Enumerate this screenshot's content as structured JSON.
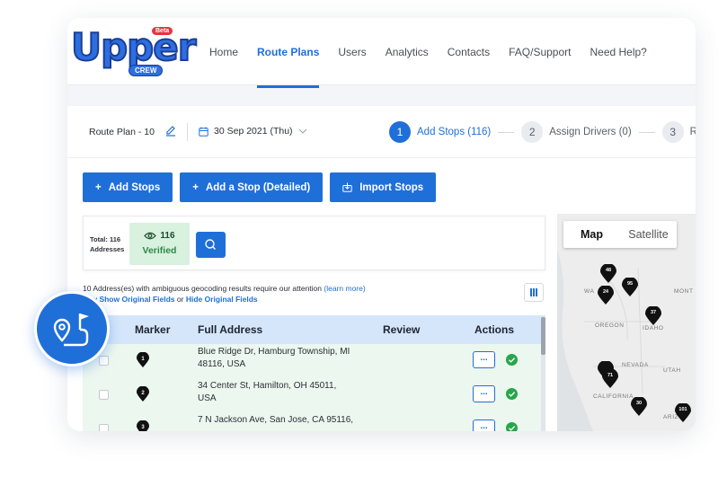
{
  "brand": {
    "logo_text": "Upper",
    "beta_label": "Beta",
    "crew_label": "CREW"
  },
  "nav": {
    "items": [
      {
        "label": "Home",
        "active": false
      },
      {
        "label": "Route Plans",
        "active": true
      },
      {
        "label": "Users",
        "active": false
      },
      {
        "label": "Analytics",
        "active": false
      },
      {
        "label": "Contacts",
        "active": false
      },
      {
        "label": "FAQ/Support",
        "active": false
      },
      {
        "label": "Need Help?",
        "active": false
      }
    ]
  },
  "plan": {
    "name": "Route Plan - 10",
    "date": "30 Sep 2021 (Thu)"
  },
  "steps": [
    {
      "num": "1",
      "label": "Add Stops (116)",
      "active": true
    },
    {
      "num": "2",
      "label": "Assign Drivers (0)",
      "active": false
    },
    {
      "num": "3",
      "label": "Re",
      "active": false
    }
  ],
  "buttons": {
    "add_stops": "Add Stops",
    "add_stop_detailed": "Add a Stop (Detailed)",
    "import_stops": "Import Stops"
  },
  "stats": {
    "total_line1": "Total: 116",
    "total_line2": "Addresses",
    "verified_count": "116",
    "verified_label": "Verified"
  },
  "note": {
    "line1": "10 Address(es) with ambiguous geocoding results require our attention",
    "learn_more": "(learn more)",
    "line2_prefix": "may",
    "show_fields": "Show Original Fields",
    "or": "or",
    "hide_fields": "Hide Original Fields"
  },
  "table": {
    "headers": {
      "marker": "Marker",
      "address": "Full Address",
      "review": "Review",
      "actions": "Actions"
    },
    "rows": [
      {
        "marker": "1",
        "address_line1": "Blue Ridge Dr, Hamburg Township, MI",
        "address_line2": "48116, USA",
        "action": "..."
      },
      {
        "marker": "2",
        "address_line1": "34 Center St, Hamilton, OH 45011,",
        "address_line2": "USA",
        "action": "..."
      },
      {
        "marker": "3",
        "address_line1": "7 N Jackson Ave, San Jose, CA 95116,",
        "address_line2": "",
        "action": "..."
      }
    ]
  },
  "map": {
    "tabs": {
      "map": "Map",
      "satellite": "Satellite"
    },
    "states": {
      "wa": "WA",
      "montana": "MONT",
      "oregon": "OREGON",
      "idaho": "IDAHO",
      "nevada": "NEVADA",
      "utah": "UTAH",
      "california": "CALIFORNIA",
      "arizona": "ARIZ"
    },
    "pins": {
      "p48": "48",
      "p95": "95",
      "p24": "24",
      "p37": "37",
      "p71": "71",
      "p30": "30",
      "p101": "101"
    }
  },
  "colors": {
    "accent": "#1f6fd9",
    "verified_bg": "#d9f1df",
    "row_bg": "#ecf7ef",
    "header_bg": "#d5e6fb",
    "success": "#27a64a"
  }
}
